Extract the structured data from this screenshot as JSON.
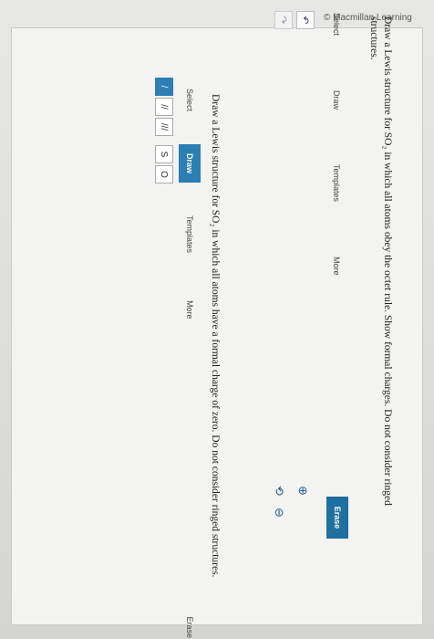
{
  "footer": {
    "copyright": "© Macmillan Learning"
  },
  "question": {
    "text": "Draw a Lewis structure for SO₂ in which all atoms obey the octet rule. Show formal charges. Do not consider ringed structures."
  },
  "toolbar": {
    "items": [
      "Select",
      "Draw",
      "Templates",
      "More"
    ],
    "erase": "Erase"
  },
  "history": {
    "undo": "↶",
    "redo": "↷"
  },
  "zoom": {
    "in": "⊕",
    "reset": "⟲",
    "out": "⊖"
  },
  "question2": {
    "text": "Draw a Lewis structure for SO₂ in which all atoms have a formal charge of zero. Do not consider ringed structures."
  },
  "toolbar2": {
    "items": [
      "Select",
      "Draw",
      "Templates",
      "More"
    ],
    "active": "Draw",
    "erase": "Erase",
    "bonds": [
      "/",
      "//",
      "///"
    ],
    "atoms": [
      "S",
      "O"
    ]
  }
}
